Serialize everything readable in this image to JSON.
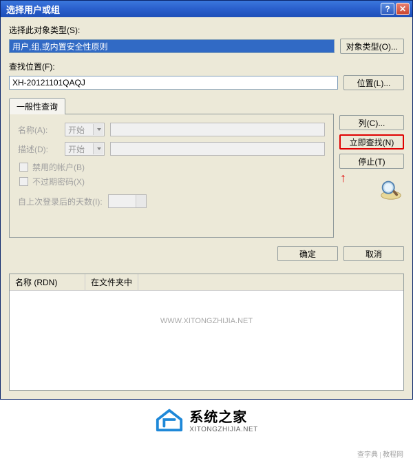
{
  "window": {
    "title": "选择用户或组"
  },
  "main": {
    "object_type_label": "选择此对象类型(S):",
    "object_type_value": "用户,组,或内置安全性原则",
    "object_type_btn": "对象类型(O)...",
    "location_label": "查找位置(F):",
    "location_value": "XH-20121101QAQJ",
    "location_btn": "位置(L)..."
  },
  "tab": {
    "label": "一般性查询",
    "name_label": "名称(A):",
    "desc_label": "描述(D):",
    "combo_value": "开始",
    "chk_disabled": "禁用的帐户(B)",
    "chk_noexpire": "不过期密码(X)",
    "days_label": "自上次登录后的天数(I):"
  },
  "side": {
    "columns_btn": "列(C)...",
    "find_btn": "立即查找(N)",
    "stop_btn": "停止(T)"
  },
  "bottom": {
    "ok": "确定",
    "cancel": "取消"
  },
  "results": {
    "col1": "名称 (RDN)",
    "col2": "在文件夹中"
  },
  "branding": {
    "cn": "系统之家",
    "en": "XITONGZHIJIA.NET"
  },
  "watermarks": {
    "center": "WWW.XITONGZHIJIA.NET",
    "right": "查字典 | 教程网"
  }
}
